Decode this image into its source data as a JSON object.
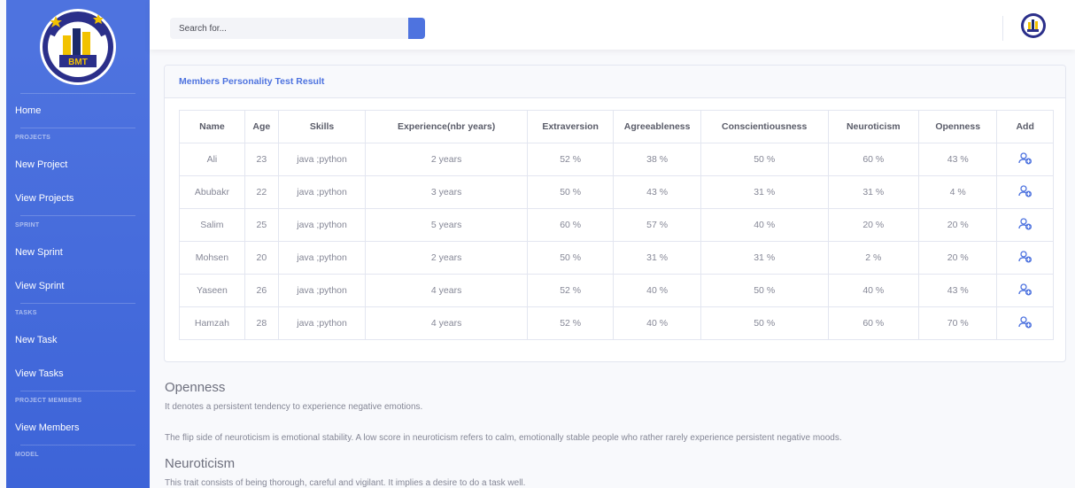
{
  "sidebar": {
    "brand_alt": "BMT",
    "items": [
      {
        "type": "item",
        "label": "Home"
      },
      {
        "type": "heading",
        "label": "PROJECTS"
      },
      {
        "type": "item",
        "label": "New Project"
      },
      {
        "type": "item",
        "label": "View Projects"
      },
      {
        "type": "heading",
        "label": "SPRINT"
      },
      {
        "type": "item",
        "label": "New Sprint"
      },
      {
        "type": "item",
        "label": "View Sprint"
      },
      {
        "type": "heading",
        "label": "TASKS"
      },
      {
        "type": "item",
        "label": "New Task"
      },
      {
        "type": "item",
        "label": "View Tasks"
      },
      {
        "type": "heading",
        "label": "PROJECT MEMBERS"
      },
      {
        "type": "item",
        "label": "View Members"
      },
      {
        "type": "heading",
        "label": "MODEL"
      }
    ]
  },
  "topbar": {
    "search_placeholder": "Search for...",
    "search_icon": "search-icon",
    "user_logo": "bmt-logo"
  },
  "card": {
    "title": "Members Personality Test Result",
    "columns": [
      "Name",
      "Age",
      "Skills",
      "Experience(nbr years)",
      "Extraversion",
      "Agreeableness",
      "Conscientiousness",
      "Neuroticism",
      "Openness",
      "Add"
    ],
    "rows": [
      [
        "Ali",
        "23",
        "java ;python",
        "2 years",
        "52 %",
        "38 %",
        "50 %",
        "60 %",
        "43 %"
      ],
      [
        "Abubakr",
        "22",
        "java ;python",
        "3 years",
        "50 %",
        "43 %",
        "31 %",
        "31 %",
        "4 %"
      ],
      [
        "Salim",
        "25",
        "java ;python",
        "5 years",
        "60 %",
        "57 %",
        "40 %",
        "20 %",
        "20 %"
      ],
      [
        "Mohsen",
        "20",
        "java ;python",
        "2 years",
        "50 %",
        "31 %",
        "31 %",
        "2 %",
        "20 %"
      ],
      [
        "Yaseen",
        "26",
        "java ;python",
        "4 years",
        "52 %",
        "40 %",
        "50 %",
        "40 %",
        "43 %"
      ],
      [
        "Hamzah",
        "28",
        "java ;python",
        "4 years",
        "52 %",
        "40 %",
        "50 %",
        "60 %",
        "70 %"
      ]
    ],
    "add_icon": "add-user-icon"
  },
  "sections": {
    "openness_title": "Openness",
    "openness_text": "It denotes a persistent tendency to experience negative emotions.",
    "flip_text": "The flip side of neuroticism is emotional stability. A low score in neuroticism refers to calm, emotionally stable people who rather rarely experience persistent negative moods.",
    "neuroticism_title": "Neuroticism",
    "neuroticism_text": "This trait consists of being thorough, careful and vigilant. It implies a desire to do a task well."
  },
  "colors": {
    "primary": "#4e73df",
    "text": "#858796",
    "heading": "#5a5c69"
  }
}
